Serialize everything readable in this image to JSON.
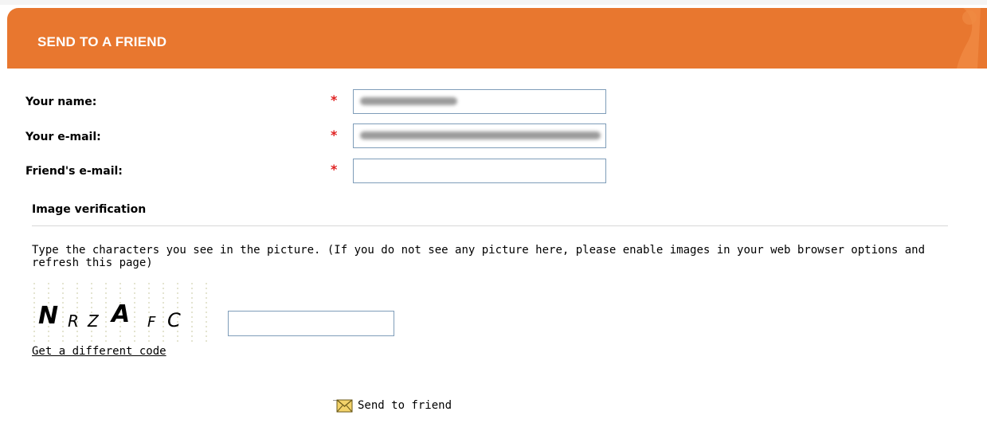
{
  "header": {
    "title": "SEND TO A FRIEND"
  },
  "form": {
    "fields": [
      {
        "label": "Your name:",
        "required_mark": "*",
        "value": ""
      },
      {
        "label": "Your e-mail:",
        "required_mark": "*",
        "value": ""
      },
      {
        "label": "Friend's e-mail:",
        "required_mark": "*",
        "value": ""
      }
    ]
  },
  "verification": {
    "title": "Image verification",
    "instructions": "Type the characters you see in the picture. (If you do not see any picture here, please enable images in your web browser options and refresh this page)",
    "captcha_text": "NRZAFC",
    "input_value": "",
    "different_code_link": "Get a different code"
  },
  "actions": {
    "send_label": "Send to friend",
    "send_icon": "envelope-icon"
  },
  "colors": {
    "header_bg": "#e8772f",
    "required": "#e02020",
    "input_border": "#7f9db9"
  }
}
